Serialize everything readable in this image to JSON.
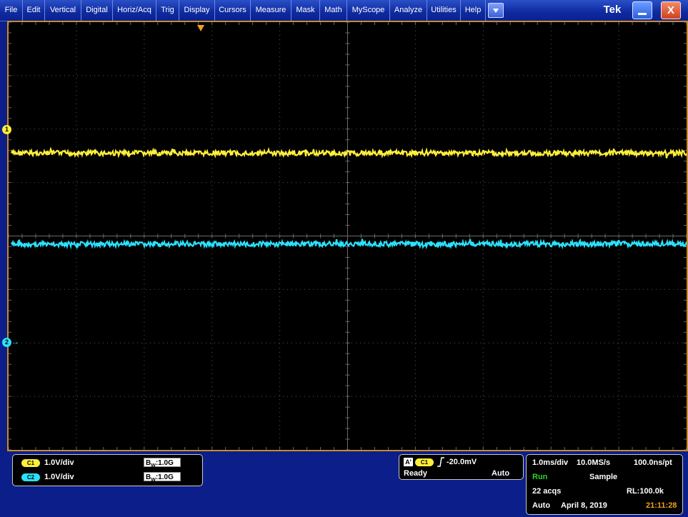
{
  "menu": {
    "items": [
      "File",
      "Edit",
      "Vertical",
      "Digital",
      "Horiz/Acq",
      "Trig",
      "Display",
      "Cursors",
      "Measure",
      "Mask",
      "Math",
      "MyScope",
      "Analyze",
      "Utilities",
      "Help"
    ],
    "dropdown_icon": "chevron-down-icon",
    "brand": "Tek",
    "minimize_icon": "minimize-icon",
    "close_label": "X"
  },
  "markers": {
    "ch1": "1",
    "ch2": "2",
    "ch2_arrow": "→"
  },
  "waveforms": [
    {
      "channel": "C1",
      "color": "#ffef3a",
      "level_div_from_top": 2.45
    },
    {
      "channel": "C2",
      "color": "#29e2ff",
      "level_div_from_top": 4.15
    }
  ],
  "channels": [
    {
      "badge": "C1",
      "scale": "1.0V/div",
      "bw_prefix": "B",
      "bw_sub": "W",
      "bw": ":1.0G",
      "color": "#ffef3a"
    },
    {
      "badge": "C2",
      "scale": "1.0V/div",
      "bw_prefix": "B",
      "bw_sub": "W",
      "bw": ":1.0G",
      "color": "#29e2ff"
    }
  ],
  "trigger": {
    "label": "A'",
    "source": "C1",
    "level": "-20.0mV",
    "state": "Ready",
    "mode": "Auto"
  },
  "horizontal": {
    "scale": "1.0ms/div",
    "sample_rate": "10.0MS/s",
    "resolution": "100.0ns/pt",
    "run_state": "Run",
    "acq_mode": "Sample",
    "acqs": "22 acqs",
    "record_length": "RL:100.0k",
    "trigger_mode": "Auto",
    "date": "April 8, 2019",
    "time": "21:11:28"
  },
  "colors": {
    "ch1": "#ffef3a",
    "ch2": "#29e2ff",
    "run": "#2bd42b",
    "time": "#f0a020",
    "frame": "#c98a2e"
  }
}
